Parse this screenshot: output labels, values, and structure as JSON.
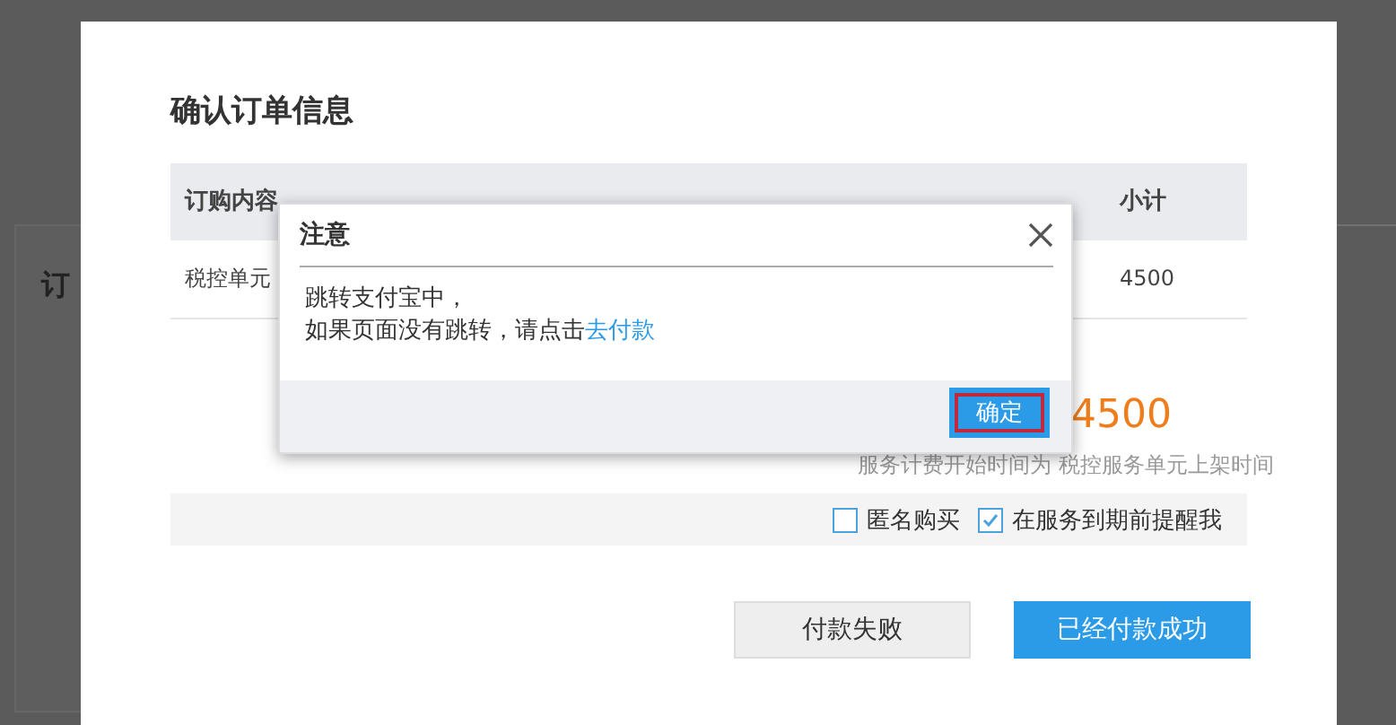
{
  "background_page": {
    "card_title": "订"
  },
  "order_dialog": {
    "title": "确认订单信息",
    "table": {
      "columns": [
        "订购内容",
        "小计"
      ],
      "rows": [
        {
          "content": "税控单元",
          "subtotal": "4500"
        }
      ]
    },
    "total": "4500",
    "note": "服务计费开始时间为 税控服务单元上架时间",
    "options": [
      {
        "label": "匿名购买",
        "checked": false
      },
      {
        "label": "在服务到期前提醒我",
        "checked": true
      }
    ],
    "buttons": [
      {
        "label": "付款失败",
        "kind": "secondary"
      },
      {
        "label": "已经付款成功",
        "kind": "primary"
      }
    ]
  },
  "notice": {
    "title": "注意",
    "line_1": "跳转支付宝中，",
    "line_2": "如果页面没有跳转，请点击",
    "link": "去付款",
    "confirm_button": {
      "label": "确定",
      "highlighted": true
    }
  }
}
